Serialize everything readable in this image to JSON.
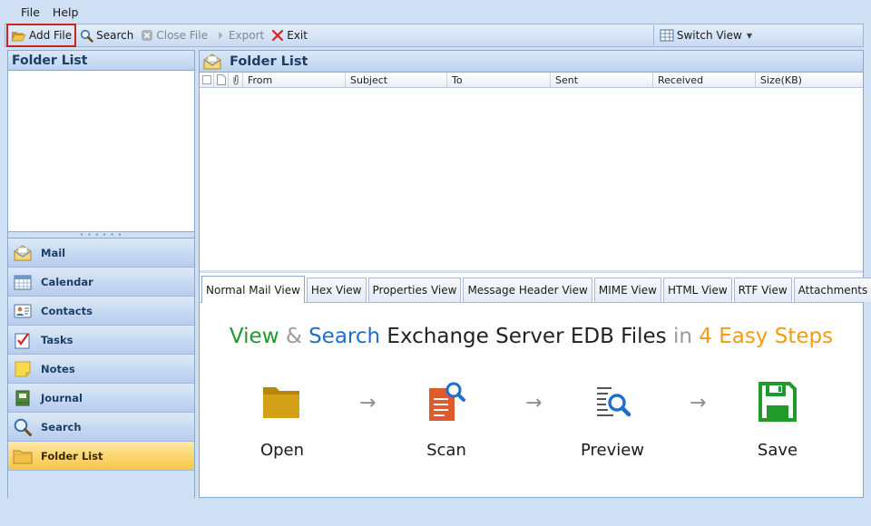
{
  "menu": {
    "file": "File",
    "help": "Help"
  },
  "toolbar": {
    "add_file": "Add File",
    "search": "Search",
    "close_file": "Close File",
    "export": "Export",
    "exit": "Exit",
    "switch_view": "Switch View"
  },
  "left_pane": {
    "title": "Folder List",
    "nav": [
      {
        "label": "Mail",
        "icon": "mail-icon"
      },
      {
        "label": "Calendar",
        "icon": "calendar-icon"
      },
      {
        "label": "Contacts",
        "icon": "contacts-icon"
      },
      {
        "label": "Tasks",
        "icon": "tasks-icon"
      },
      {
        "label": "Notes",
        "icon": "notes-icon"
      },
      {
        "label": "Journal",
        "icon": "journal-icon"
      },
      {
        "label": "Search",
        "icon": "search-icon"
      },
      {
        "label": "Folder List",
        "icon": "folder-icon",
        "active": true
      }
    ]
  },
  "right_pane": {
    "title": "Folder List",
    "columns": [
      "From",
      "Subject",
      "To",
      "Sent",
      "Received",
      "Size(KB)"
    ],
    "tabs": [
      "Normal Mail View",
      "Hex View",
      "Properties View",
      "Message Header View",
      "MIME View",
      "HTML View",
      "RTF View",
      "Attachments"
    ],
    "active_tab": "Normal Mail View"
  },
  "banner": {
    "title_parts": [
      "View",
      "&",
      "Search",
      "Exchange Server EDB Files",
      "in",
      "4 Easy Steps"
    ],
    "steps": [
      "Open",
      "Scan",
      "Preview",
      "Save"
    ],
    "arrow": "→"
  },
  "colors": {
    "green": "#1f9a2b",
    "blue": "#1e6fc8",
    "orange": "#f39c12",
    "accent_active": "#fbd56b",
    "highlight_border": "#d02020"
  }
}
